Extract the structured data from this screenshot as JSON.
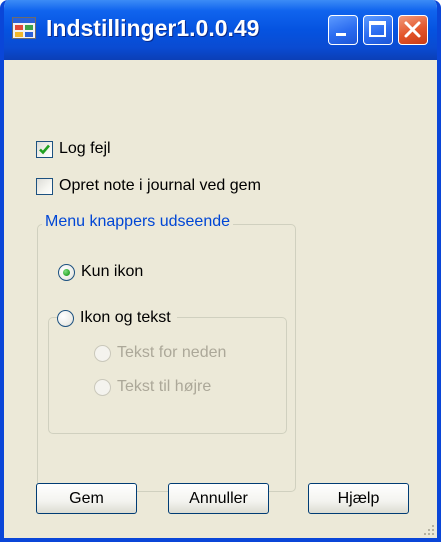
{
  "window": {
    "title": "Indstillinger1.0.0.49"
  },
  "options": {
    "log_errors": {
      "label": "Log fejl",
      "checked": true
    },
    "create_note": {
      "label": "Opret note i journal ved gem",
      "checked": false
    }
  },
  "menu_group": {
    "title": "Menu knappers udseende",
    "icon_only": {
      "label": "Kun ikon",
      "selected": true
    },
    "icon_text": {
      "label": "Ikon og tekst",
      "selected": false
    },
    "text_below": {
      "label": "Tekst for neden",
      "enabled": false
    },
    "text_right": {
      "label": "Tekst til højre",
      "enabled": false
    }
  },
  "buttons": {
    "save": "Gem",
    "cancel": "Annuller",
    "help": "Hjælp"
  },
  "colors": {
    "title_bar": "#0553e0",
    "window_bg": "#ece9d8",
    "group_title": "#0046d5",
    "check_mark": "#21a121",
    "close_button": "#e3552a"
  },
  "icons": {
    "app": "settings-window-icon",
    "minimize": "minimize-icon",
    "maximize": "maximize-icon",
    "close": "close-icon",
    "check": "check-icon",
    "grip": "resize-grip-icon"
  }
}
